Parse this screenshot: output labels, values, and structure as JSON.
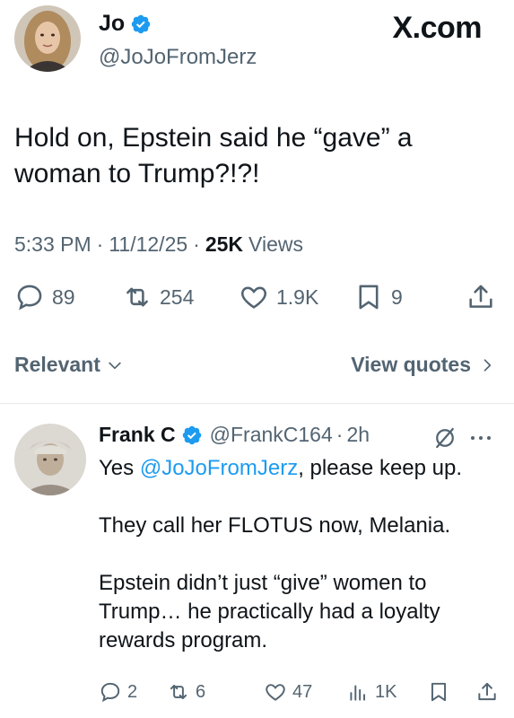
{
  "main_tweet": {
    "display_name": "Jo",
    "handle": "@JoJoFromJerz",
    "brand": "X.com",
    "text": "Hold on, Epstein said he “gave” a\nwoman to Trump?!?!",
    "time": "5:33 PM",
    "date": "11/12/25",
    "views_count": "25K",
    "views_label": "Views",
    "replies": "89",
    "reposts": "254",
    "likes": "1.9K",
    "bookmarks": "9"
  },
  "sort": {
    "label": "Relevant",
    "view_quotes": "View quotes"
  },
  "reply": {
    "display_name": "Frank C",
    "handle": "@FrankC164",
    "time": "2h",
    "line1_prefix": "Yes ",
    "line1_mention": "@JoJoFromJerz",
    "line1_suffix": ", please keep up.",
    "paragraph2": "They call her FLOTUS now, Melania.",
    "paragraph3": "Epstein didn’t just “give” women to Trump… he practically had a loyalty rewards program.",
    "replies": "2",
    "reposts": "6",
    "likes": "47",
    "views": "1K"
  },
  "colors": {
    "text": "#0f1419",
    "secondary": "#536471",
    "accent": "#1d9bf0",
    "divider": "#e6e9eb"
  },
  "icons": [
    "verified-badge-icon",
    "reply-icon",
    "repost-icon",
    "like-icon",
    "bookmark-icon",
    "share-icon",
    "chevron-down-icon",
    "chevron-right-icon",
    "grok-icon",
    "more-icon",
    "views-icon"
  ]
}
